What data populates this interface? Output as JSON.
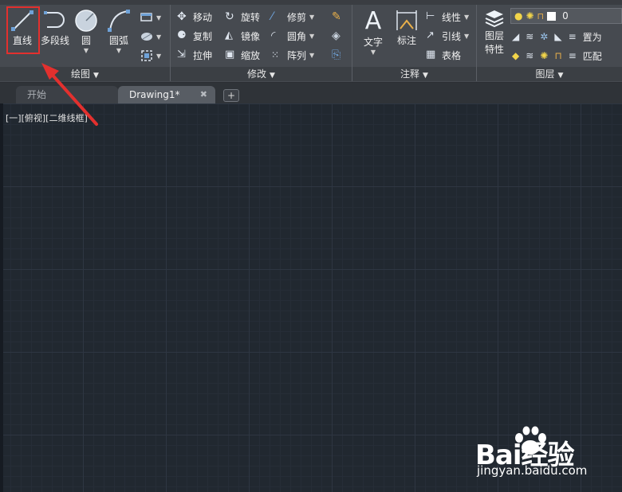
{
  "ribbon": {
    "draw_panel": {
      "title": "绘图",
      "line_label": "直线",
      "polyline_label": "多段线",
      "circle_label": "圆",
      "arc_label": "圆弧"
    },
    "modify_panel": {
      "title": "修改",
      "move_label": "移动",
      "rotate_label": "旋转",
      "trim_label": "修剪",
      "copy_label": "复制",
      "mirror_label": "镜像",
      "fillet_label": "圆角",
      "stretch_label": "拉伸",
      "scale_label": "缩放",
      "array_label": "阵列"
    },
    "annotation_panel": {
      "title": "注释",
      "text_label": "文字",
      "dimension_label": "标注",
      "linear_label": "线性",
      "leader_label": "引线",
      "table_label": "表格"
    },
    "layers_panel": {
      "title": "图层",
      "layer_properties_label_1": "图层",
      "layer_properties_label_2": "特性",
      "current_layer": "0",
      "set_current_label": "置为",
      "match_label": "匹配"
    }
  },
  "doc_tabs": {
    "start_label": "开始",
    "drawing_label": "Drawing1*",
    "close_glyph": "✖",
    "add_glyph": "+"
  },
  "canvas": {
    "viewport_label": "[一][俯视][二维线框]"
  },
  "watermark": {
    "logo_text": "Bai经验",
    "url": "jingyan.baidu.com"
  },
  "colors": {
    "canvas_bg": "#212830",
    "ribbon_bg": "#464a50",
    "highlight": "#e3302e",
    "arrow": "#e3302e"
  }
}
